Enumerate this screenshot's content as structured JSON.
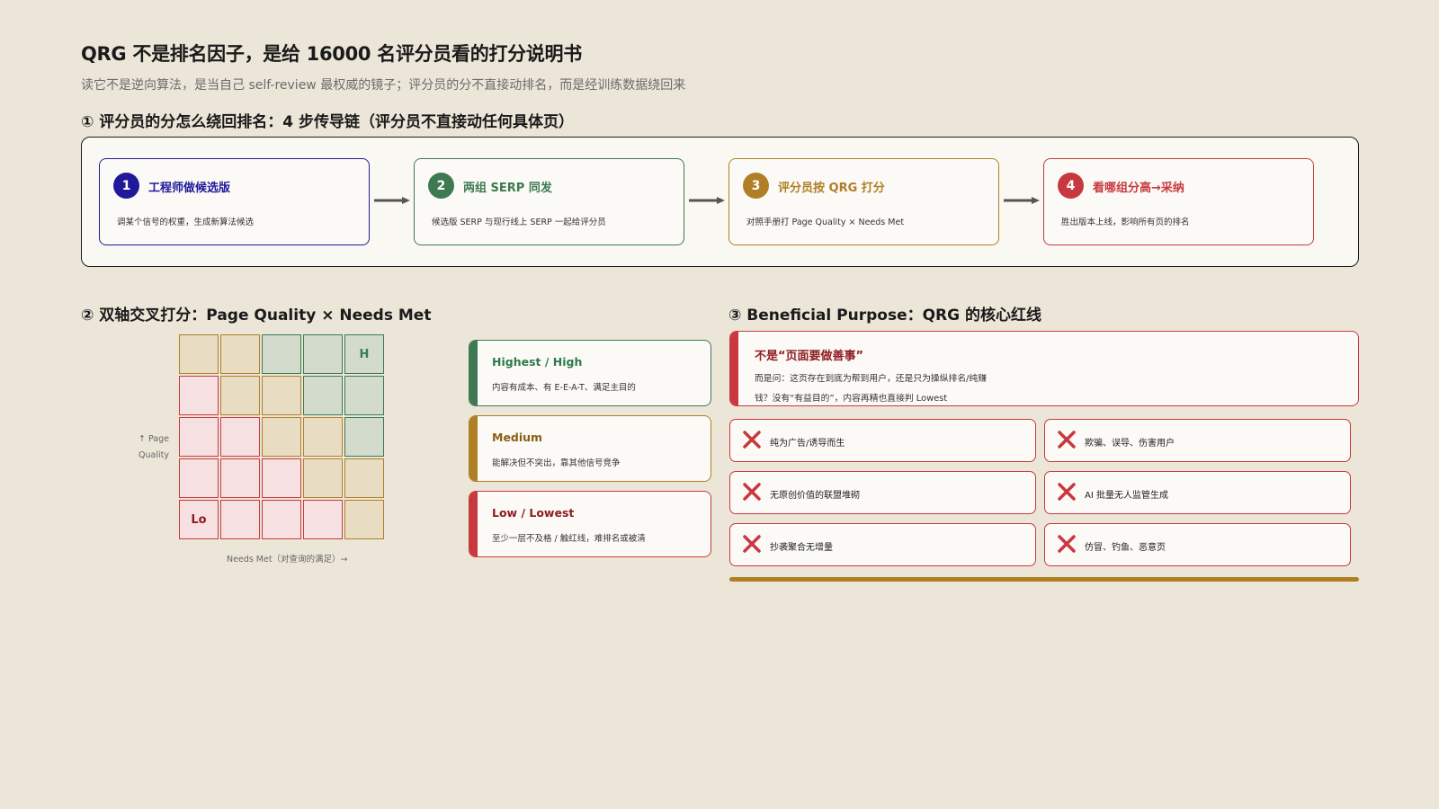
{
  "title": "QRG 不是排名因子，是给 16000 名评分员看的打分说明书",
  "subtitle": "读它不是逆向算法，是当自己 self-review 最权威的镜子；评分员的分不直接动排名，而是经训练数据绕回来",
  "section1": {
    "heading": "① 评分员的分怎么绕回排名：4 步传导链（评分员不直接动任何具体页）",
    "steps": [
      {
        "num": "1",
        "title": "工程师做候选版",
        "desc": "调某个信号的权重，生成新算法候选",
        "color": "#201a9a"
      },
      {
        "num": "2",
        "title": "两组 SERP 同发",
        "desc": "候选版 SERP 与现行线上 SERP 一起给评分员",
        "color": "#3d7a52"
      },
      {
        "num": "3",
        "title": "评分员按 QRG 打分",
        "desc": "对照手册打 Page Quality × Needs Met",
        "color": "#b07f25"
      },
      {
        "num": "4",
        "title": "看哪组分高→采纳",
        "desc": "胜出版本上线，影响所有页的排名",
        "color": "#c8393f"
      }
    ]
  },
  "section2": {
    "heading": "② 双轴交叉打分：Page Quality × Needs Met",
    "y_axis_label": "↑ Page Quality",
    "x_axis_label": "Needs Met（对查询的满足）→",
    "grid_rows": [
      [
        "mid",
        "mid",
        "high",
        "high",
        "high"
      ],
      [
        "low",
        "mid",
        "mid",
        "high",
        "high"
      ],
      [
        "low",
        "low",
        "mid",
        "mid",
        "high"
      ],
      [
        "low",
        "low",
        "low",
        "mid",
        "mid"
      ],
      [
        "low",
        "low",
        "low",
        "low",
        "mid"
      ]
    ],
    "grid_labels": {
      "top_right": "H",
      "bottom_left": "Lo"
    },
    "legend": [
      {
        "title": "Highest / High",
        "desc": "内容有成本、有 E-E-A-T、满足主目的",
        "color": "#3d7a52"
      },
      {
        "title": "Medium",
        "desc": "能解决但不突出，靠其他信号竞争",
        "color": "#b07f25"
      },
      {
        "title": "Low / Lowest",
        "desc": "至少一层不及格 / 触红线，难排名或被清",
        "color": "#c8393f"
      }
    ]
  },
  "section3": {
    "heading": "③ Beneficial Purpose：QRG 的核心红线",
    "main_title": "不是“页面要做善事”",
    "main_desc": "而是问：这页存在到底为帮到用户，还是只为操纵排名/纯赚钱？没有“有益目的”，内容再精也直接判 Lowest",
    "items": [
      "纯为广告/诱导而生",
      "欺骗、误导、伤害用户",
      "无原创价值的联盟堆砌",
      "AI 批量无人监管生成",
      "抄袭聚合无增量",
      "仿冒、钓鱼、恶意页"
    ]
  },
  "colors": {
    "navy": "#201a9a",
    "green": "#3d7a52",
    "gold": "#b07f25",
    "red": "#c8393f",
    "cell_high_fill": "#d3dbcc",
    "cell_mid_fill": "#e8dcc3",
    "cell_low_fill": "#f7e0e1"
  },
  "icons": {
    "arrow": "arrow-right-icon",
    "cross": "x-mark-icon"
  }
}
